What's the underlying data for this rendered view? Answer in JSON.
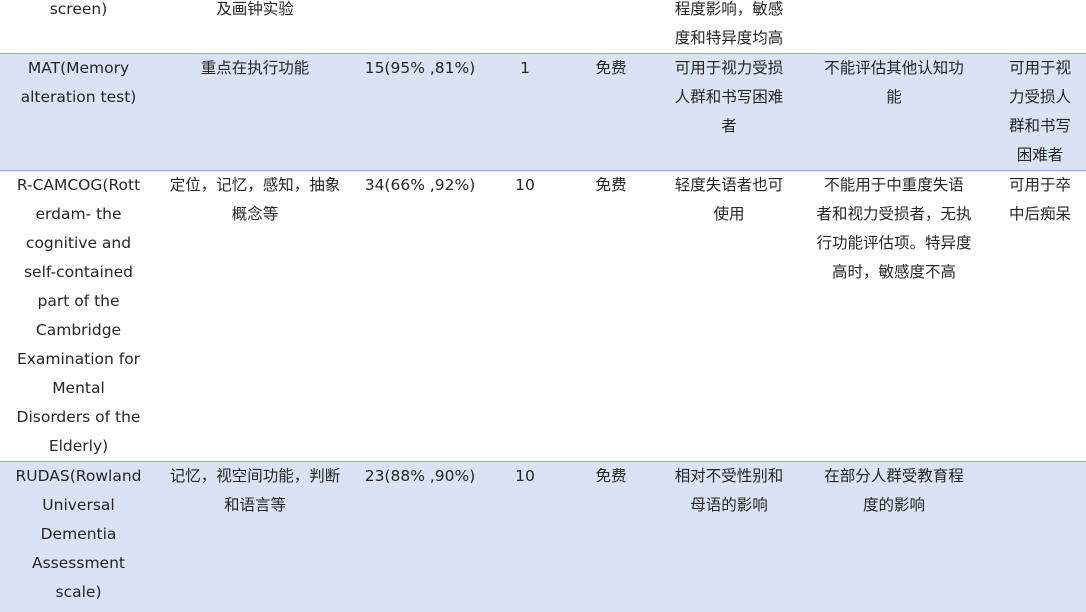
{
  "table": {
    "rows": [
      {
        "shaded": false,
        "name": "screen)",
        "content": "及画钟实验",
        "items": "",
        "time": "",
        "cost": "",
        "advantage": "程度影响，敏感度和特异度均高",
        "disadvantage": "",
        "notes": ""
      },
      {
        "shaded": true,
        "name": "MAT(Memory alteration test)",
        "content": "重点在执行功能",
        "items": "15(95% ,81%)",
        "time": "1",
        "cost": "免费",
        "advantage": "可用于视力受损人群和书写困难者",
        "disadvantage": "不能评估其他认知功能",
        "notes": "可用于视力受损人群和书写困难者"
      },
      {
        "shaded": false,
        "name": "R-CAMCOG(Rotterdam- the cognitive and self-contained part of the Cambridge Examination for Mental Disorders of the Elderly)",
        "content": "定位，记忆，感知，抽象概念等",
        "items": "34(66% ,92%)",
        "time": "10",
        "cost": "免费",
        "advantage": "轻度失语者也可使用",
        "disadvantage": "不能用于中重度失语者和视力受损者，无执行功能评估项。特异度高时，敏感度不高",
        "notes": "可用于卒中后痴呆"
      },
      {
        "shaded": true,
        "name": "RUDAS(Rowland Universal Dementia Assessment scale)",
        "content": "记忆，视空间功能，判断和语言等",
        "items": "23(88% ,90%)",
        "time": "10",
        "cost": "免费",
        "advantage": "相对不受性别和母语的影响",
        "disadvantage": "在部分人群受教育程度的影响",
        "notes": ""
      }
    ]
  },
  "display_lines": {
    "r0": {
      "name": [
        "screen)"
      ],
      "content": [
        "及画钟实验"
      ],
      "advantage": [
        "程度影响，敏感",
        "度和特异度均高"
      ]
    },
    "r1": {
      "name": [
        "MAT(Memory",
        "alteration test)"
      ],
      "content": [
        "重点在执行功能"
      ],
      "advantage": [
        "可用于视力受损",
        "人群和书写困难",
        "者"
      ],
      "disadvantage": [
        "不能评估其他认知功",
        "能"
      ],
      "notes": [
        "可用于视",
        "力受损人",
        "群和书写",
        "困难者"
      ]
    },
    "r2": {
      "name": [
        "R-CAMCOG(Rott",
        "erdam- the",
        "cognitive and",
        "self-contained",
        "part of the",
        "Cambridge",
        "Examination for",
        "Mental",
        "Disorders of the",
        "Elderly)"
      ],
      "content": [
        "定位，记忆，感知，抽象",
        "概念等"
      ],
      "advantage": [
        "轻度失语者也可",
        "使用"
      ],
      "disadvantage": [
        "不能用于中重度失语",
        "者和视力受损者，无执",
        "行功能评估项。特异度",
        "高时，敏感度不高"
      ],
      "notes": [
        "可用于卒",
        "中后痴呆"
      ]
    },
    "r3": {
      "name": [
        "RUDAS(Rowland",
        "Universal",
        "Dementia",
        "Assessment",
        "scale)"
      ],
      "content": [
        "记忆，视空间功能，判断",
        "和语言等"
      ],
      "advantage": [
        "相对不受性别和",
        "母语的影响"
      ],
      "disadvantage": [
        "在部分人群受教育程",
        "度的影响"
      ]
    }
  }
}
